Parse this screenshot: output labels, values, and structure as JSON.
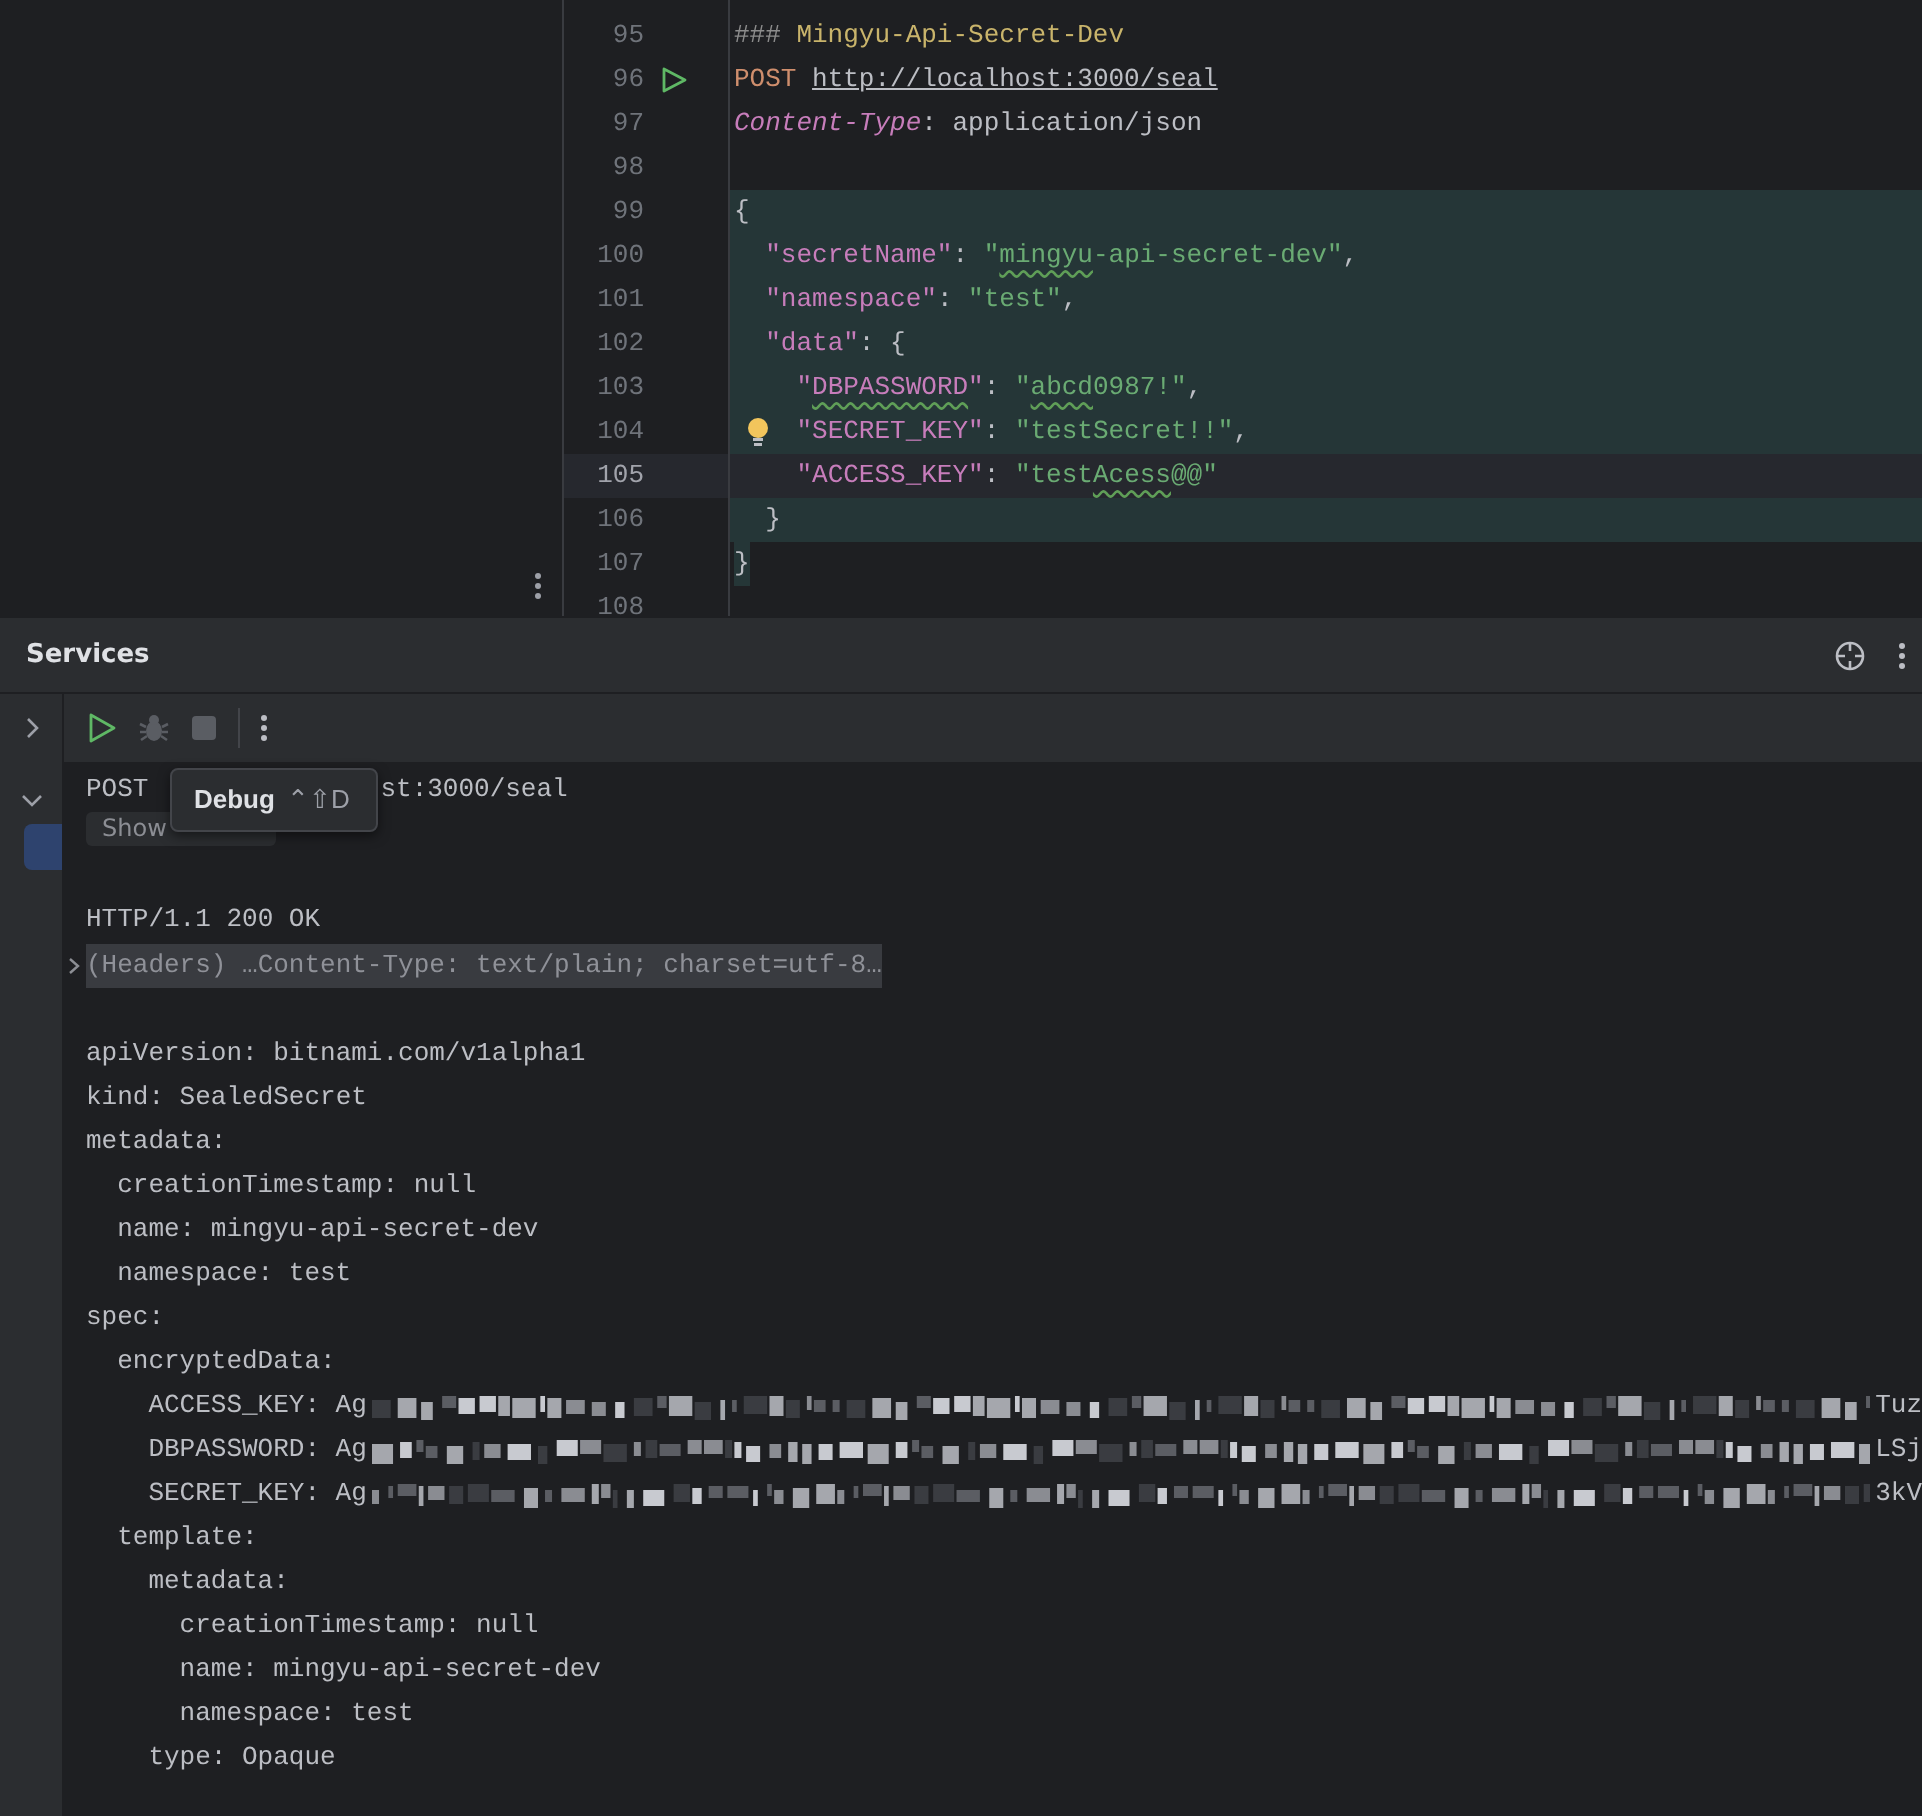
{
  "editor": {
    "lines": [
      {
        "number": "95",
        "selected": false,
        "current": false,
        "tokens": [
          {
            "kind": "comment",
            "text": "###"
          },
          {
            "kind": "title",
            "text": " Mingyu-Api-Secret-Dev"
          }
        ]
      },
      {
        "number": "96",
        "selected": false,
        "current": false,
        "run_icon": true,
        "tokens": [
          {
            "kind": "method",
            "text": "POST "
          },
          {
            "kind": "url",
            "text": "http://localhost:3000/seal"
          }
        ]
      },
      {
        "number": "97",
        "selected": false,
        "current": false,
        "tokens": [
          {
            "kind": "header",
            "text": "Content-Type"
          },
          {
            "kind": "punct",
            "text": ": application/json"
          }
        ]
      },
      {
        "number": "98",
        "selected": false,
        "current": false
      },
      {
        "number": "99",
        "selected": true,
        "current": false,
        "tokens": [
          {
            "kind": "punct",
            "text": "{"
          }
        ]
      },
      {
        "number": "100",
        "selected": true,
        "current": false,
        "tokens": [
          {
            "kind": "key",
            "text": "  \"secretName\""
          },
          {
            "kind": "punct",
            "text": ": "
          },
          {
            "kind": "string",
            "text": "\""
          },
          {
            "kind": "string",
            "text": "mingyu",
            "typo": true
          },
          {
            "kind": "string",
            "text": "-api-secret-dev\""
          },
          {
            "kind": "punct",
            "text": ","
          }
        ]
      },
      {
        "number": "101",
        "selected": true,
        "current": false,
        "tokens": [
          {
            "kind": "key",
            "text": "  \"namespace\""
          },
          {
            "kind": "punct",
            "text": ": "
          },
          {
            "kind": "string",
            "text": "\"test\""
          },
          {
            "kind": "punct",
            "text": ","
          }
        ]
      },
      {
        "number": "102",
        "selected": true,
        "current": false,
        "tokens": [
          {
            "kind": "key",
            "text": "  \"data\""
          },
          {
            "kind": "punct",
            "text": ": {"
          }
        ]
      },
      {
        "number": "103",
        "selected": true,
        "current": false,
        "tokens": [
          {
            "kind": "key",
            "text": "    \""
          },
          {
            "kind": "key",
            "text": "DBPASSWORD",
            "typo": true
          },
          {
            "kind": "key",
            "text": "\""
          },
          {
            "kind": "punct",
            "text": ": "
          },
          {
            "kind": "string",
            "text": "\""
          },
          {
            "kind": "string",
            "text": "abcd",
            "typo": true
          },
          {
            "kind": "string",
            "text": "0987!\""
          },
          {
            "kind": "punct",
            "text": ","
          }
        ]
      },
      {
        "number": "104",
        "selected": true,
        "current": false,
        "hint_icon": true,
        "tokens": [
          {
            "kind": "key",
            "text": "    \"SECRET_KEY\""
          },
          {
            "kind": "punct",
            "text": ": "
          },
          {
            "kind": "string",
            "text": "\"testSecret!!\""
          },
          {
            "kind": "punct",
            "text": ","
          }
        ]
      },
      {
        "number": "105",
        "selected": false,
        "current": true,
        "tokens": [
          {
            "kind": "key",
            "text": "    \"ACCESS_KEY\""
          },
          {
            "kind": "punct",
            "text": ": "
          },
          {
            "kind": "string",
            "text": "\"test"
          },
          {
            "kind": "string",
            "text": "Acess",
            "typo": true
          },
          {
            "kind": "string",
            "text": "@@\""
          }
        ]
      },
      {
        "number": "106",
        "selected": true,
        "current": false,
        "tokens": [
          {
            "kind": "punct",
            "text": "  }"
          }
        ]
      },
      {
        "number": "107",
        "selected": true,
        "current": false,
        "tokens": [
          {
            "kind": "punct",
            "text": "}"
          }
        ]
      },
      {
        "number": "108",
        "selected": false,
        "current": false
      }
    ]
  },
  "services": {
    "title": "Services",
    "toolbar": [
      {
        "kind": "run",
        "disabled": false
      },
      {
        "kind": "debug",
        "disabled": true
      },
      {
        "kind": "stop",
        "disabled": true
      },
      {
        "kind": "more"
      }
    ],
    "tooltip": {
      "label": "Debug",
      "shortcut": "⌃⇧D"
    },
    "request_parts": [
      "POST",
      "st:3000/seal"
    ],
    "show_request": "Show",
    "status_line": "HTTP/1.1 200 OK",
    "headers_line": "(Headers) …Content-Type: text/plain; charset=utf-8…",
    "body": [
      {
        "text": "apiVersion: bitnami.com/v1alpha1"
      },
      {
        "text": "kind: SealedSecret"
      },
      {
        "text": "metadata:",
        "children": [
          {
            "text": "creationTimestamp: null"
          },
          {
            "text": "name: mingyu-api-secret-dev"
          },
          {
            "text": "namespace: test"
          }
        ]
      },
      {
        "text": "spec:",
        "children": [
          {
            "text": "encryptedData:",
            "children": [
              {
                "text": "ACCESS_KEY: Ag",
                "redacted": true,
                "tail": "Tuz"
              },
              {
                "text": "DBPASSWORD: Ag",
                "redacted": true,
                "tail": "LSj"
              },
              {
                "text": "SECRET_KEY: Ag",
                "redacted": true,
                "tail": "3kV"
              }
            ]
          },
          {
            "text": "template:",
            "children": [
              {
                "text": "metadata:",
                "children": [
                  {
                    "text": "creationTimestamp: null"
                  },
                  {
                    "text": "name: mingyu-api-secret-dev"
                  },
                  {
                    "text": "namespace: test"
                  }
                ]
              },
              {
                "text": "type: Opaque"
              }
            ]
          }
        ]
      }
    ]
  }
}
